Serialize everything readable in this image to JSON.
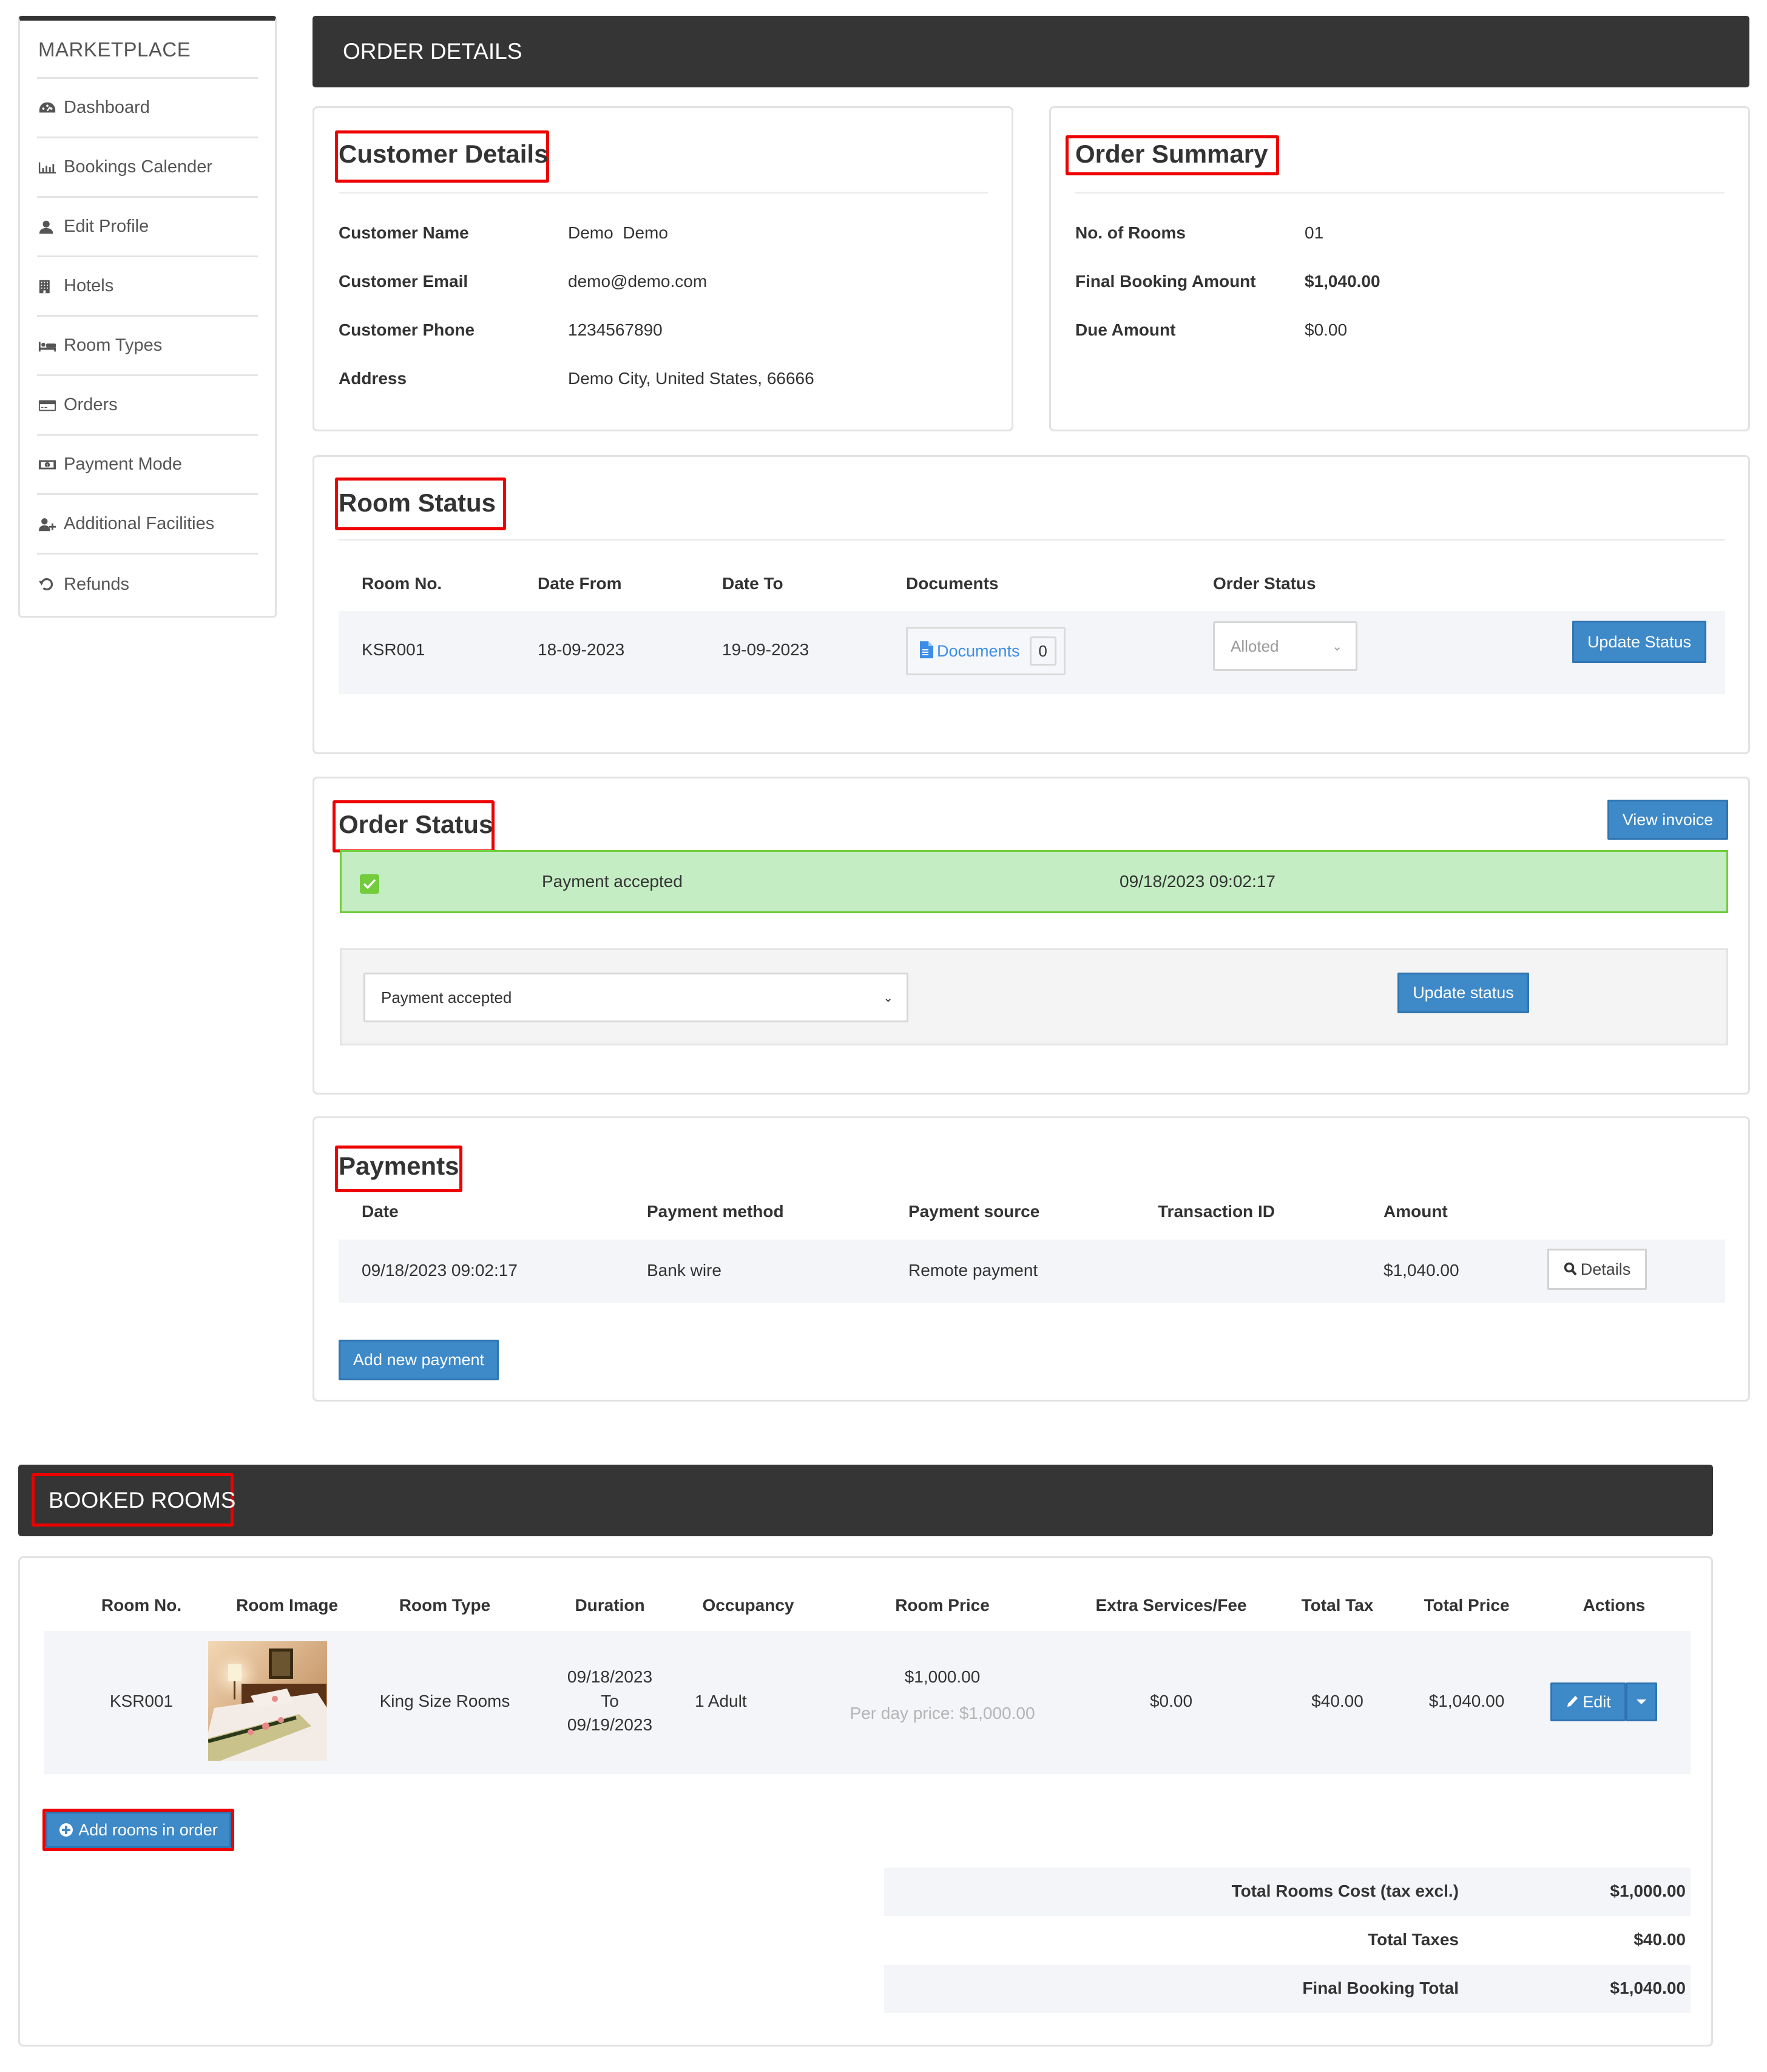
{
  "sidebar": {
    "title": "MARKETPLACE",
    "items": [
      {
        "label": "Dashboard",
        "icon": "dashboard-icon"
      },
      {
        "label": "Bookings Calender",
        "icon": "bar-chart-icon"
      },
      {
        "label": "Edit Profile",
        "icon": "user-icon"
      },
      {
        "label": "Hotels",
        "icon": "building-icon"
      },
      {
        "label": "Room Types",
        "icon": "bed-icon"
      },
      {
        "label": "Orders",
        "icon": "credit-card-icon"
      },
      {
        "label": "Payment Mode",
        "icon": "money-icon"
      },
      {
        "label": "Additional Facilities",
        "icon": "user-plus-icon"
      },
      {
        "label": "Refunds",
        "icon": "undo-icon"
      }
    ]
  },
  "header": {
    "title": "ORDER DETAILS"
  },
  "customer_details": {
    "heading": "Customer Details",
    "fields": [
      {
        "label": "Customer Name",
        "value": "Demo  Demo"
      },
      {
        "label": "Customer Email",
        "value": "demo@demo.com"
      },
      {
        "label": "Customer Phone",
        "value": "1234567890"
      },
      {
        "label": "Address",
        "value": "Demo City, United States, 66666"
      }
    ]
  },
  "order_summary": {
    "heading": "Order Summary",
    "fields": [
      {
        "label": "No. of Rooms",
        "value": "01"
      },
      {
        "label": "Final Booking Amount",
        "value": "$1,040.00"
      },
      {
        "label": "Due Amount",
        "value": "$0.00"
      }
    ]
  },
  "room_status": {
    "heading": "Room Status",
    "columns": [
      "Room No.",
      "Date From",
      "Date To",
      "Documents",
      "Order Status"
    ],
    "rows": [
      {
        "room_no": "KSR001",
        "date_from": "18-09-2023",
        "date_to": "19-09-2023",
        "documents_label": "Documents",
        "documents_count": "0",
        "order_status": "Alloted",
        "button": "Update Status"
      }
    ]
  },
  "order_status": {
    "heading": "Order Status",
    "view_invoice": "View invoice",
    "history": [
      {
        "status": "Payment accepted",
        "datetime": "09/18/2023 09:02:17"
      }
    ],
    "select_value": "Payment accepted",
    "update_button": "Update status",
    "colors": {
      "success_bg": "#c4edc4",
      "success_border": "#72cc3c"
    }
  },
  "payments": {
    "heading": "Payments",
    "columns": [
      "Date",
      "Payment method",
      "Payment source",
      "Transaction ID",
      "Amount"
    ],
    "rows": [
      {
        "date": "09/18/2023 09:02:17",
        "method": "Bank wire",
        "source": "Remote payment",
        "transaction_id": "",
        "amount": "$1,040.00",
        "details_button": "Details"
      }
    ],
    "add_button": "Add new payment"
  },
  "booked_rooms": {
    "title": "BOOKED ROOMS",
    "columns": [
      "Room No.",
      "Room Image",
      "Room Type",
      "Duration",
      "Occupancy",
      "Room Price",
      "Extra Services/Fee",
      "Total Tax",
      "Total Price",
      "Actions"
    ],
    "rows": [
      {
        "room_no": "KSR001",
        "room_type": "King Size Rooms",
        "duration_from": "09/18/2023",
        "duration_to_label": "To",
        "duration_to": "09/19/2023",
        "occupancy": "1 Adult",
        "room_price": "$1,000.00",
        "per_day_price": "Per day price: $1,000.00",
        "extra_services": "$0.00",
        "total_tax": "$40.00",
        "total_price": "$1,040.00",
        "edit_button": "Edit"
      }
    ],
    "add_rooms_button": "Add rooms in order",
    "totals": [
      {
        "label": "Total Rooms Cost (tax excl.)",
        "value": "$1,000.00"
      },
      {
        "label": "Total Taxes",
        "value": "$40.00"
      },
      {
        "label": "Final Booking Total",
        "value": "$1,040.00"
      }
    ]
  },
  "colors": {
    "header_bg": "#353535",
    "primary_button": "#3e89c8",
    "link_blue": "#3b8ee8",
    "annotation_red": "#ee0000",
    "row_bg": "#f4f5f8"
  }
}
